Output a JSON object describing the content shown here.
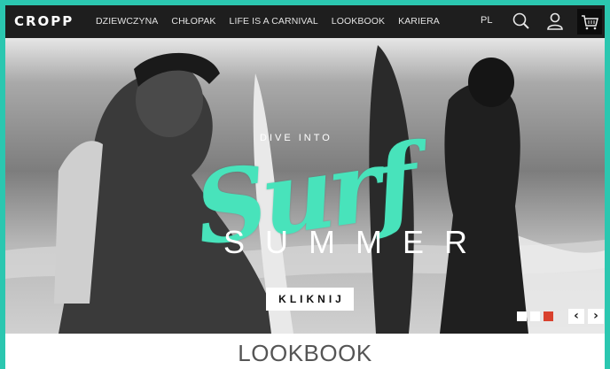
{
  "header": {
    "logo": "CROPP",
    "menu": [
      "DZIEWCZYNA",
      "CHŁOPAK",
      "LIFE IS A CARNIVAL",
      "LOOKBOOK",
      "KARIERA"
    ],
    "language": "PL",
    "icons": [
      "search-icon",
      "user-icon",
      "cart-icon"
    ]
  },
  "hero": {
    "line1": "DIVE INTO",
    "script_word": "Surf",
    "line2": "SUMMER",
    "cta_label": "KLIKNIJ",
    "slides": 3,
    "active_slide": 3,
    "prev_arrow": "‹",
    "next_arrow": "›"
  },
  "section": {
    "title": "LOOKBOOK"
  },
  "colors": {
    "nav_bg": "#1e1e1e",
    "accent_teal": "#48e3bb",
    "border_teal": "#2bc7b0",
    "active_dot": "#d9412e"
  }
}
